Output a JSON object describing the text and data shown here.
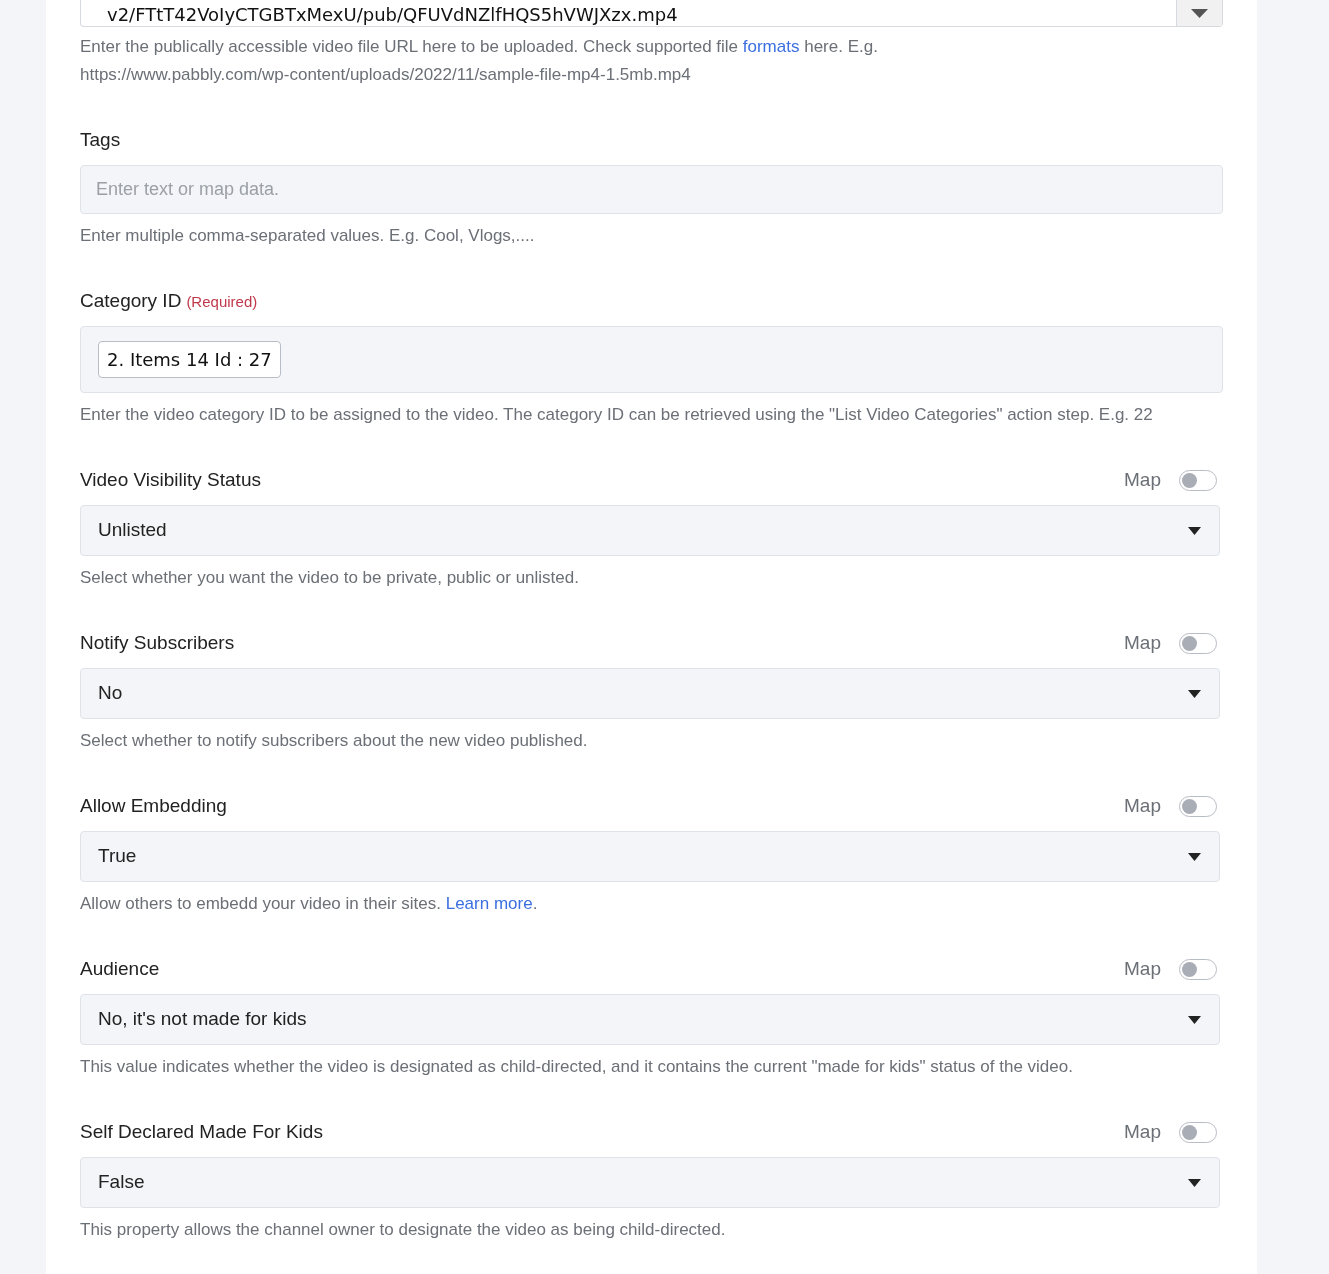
{
  "url_field": {
    "value": "v2/FTtT42VoIyCTGBTxMexU/pub/QFUVdNZlfHQS5hVWJXzx.mp4",
    "help_before": "Enter the publically accessible video file URL here to be uploaded. Check supported file ",
    "help_link": "formats",
    "help_after": " here. E.g.",
    "help_example": "https://www.pabbly.com/wp-content/uploads/2022/11/sample-file-mp4-1.5mb.mp4"
  },
  "fields": [
    {
      "kind": "text",
      "label": "Tags",
      "placeholder": "Enter text or map data.",
      "help": "Enter multiple comma-separated values. E.g. Cool, Vlogs,...."
    },
    {
      "kind": "chips",
      "label": "Category ID",
      "required": "(Required)",
      "chips": [
        "2. Items 14 Id : 27"
      ],
      "help": "Enter the video category ID to be assigned to the video. The category ID can be retrieved using the \"List Video Categories\" action step. E.g. 22"
    },
    {
      "kind": "select",
      "label": "Video Visibility Status",
      "map_label": "Map",
      "map_on": false,
      "value": "Unlisted",
      "help": "Select whether you want the video to be private, public or unlisted."
    },
    {
      "kind": "select",
      "label": "Notify Subscribers",
      "map_label": "Map",
      "map_on": false,
      "value": "No",
      "help": "Select whether to notify subscribers about the new video published."
    },
    {
      "kind": "select",
      "label": "Allow Embedding",
      "map_label": "Map",
      "map_on": false,
      "value": "True",
      "help": "Allow others to embedd your video in their sites. ",
      "help_link": "Learn more",
      "help_after": "."
    },
    {
      "kind": "select",
      "label": "Audience",
      "map_label": "Map",
      "map_on": false,
      "value": "No, it's not made for kids",
      "help": "This value indicates whether the video is designated as child-directed, and it contains the current \"made for kids\" status of the video."
    },
    {
      "kind": "select",
      "label": "Self Declared Made For Kids",
      "map_label": "Map",
      "map_on": false,
      "value": "False",
      "help": "This property allows the channel owner to designate the video as being child-directed."
    }
  ]
}
